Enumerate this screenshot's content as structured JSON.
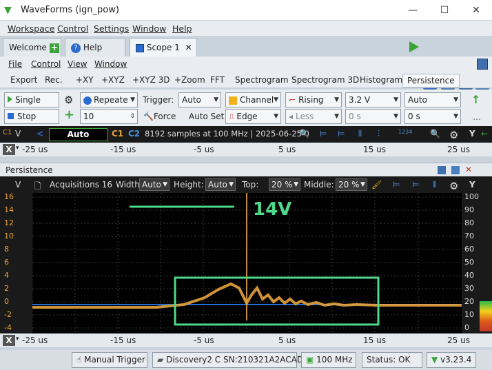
{
  "window": {
    "title": "WaveForms (ign_pow)"
  },
  "menu": [
    "Workspace",
    "Control",
    "Settings",
    "Window",
    "Help"
  ],
  "tabs": [
    {
      "label": "Welcome"
    },
    {
      "label": "Help"
    },
    {
      "label": "Scope 1"
    }
  ],
  "scope_menu": [
    "File",
    "Control",
    "View",
    "Window"
  ],
  "toolbar": [
    "Export",
    "Rec.",
    "+XY",
    "+XYZ",
    "+XYZ 3D",
    "+Zoom",
    "FFT",
    "Spectrogram",
    "Spectrogram 3D",
    "Histogram",
    "Persistence"
  ],
  "controls": {
    "single": "Single",
    "stop": "Stop",
    "repeat": "Repeate",
    "count": "10",
    "trigger_label": "Trigger:",
    "trigger_mode": "Auto",
    "force": "Force",
    "auto_set": "Auto Set",
    "source": "Channel",
    "type": "Edge",
    "condition": "Rising",
    "filter": "Less",
    "level": "3.2 V",
    "holdoff": "0 s",
    "auto2": "Auto",
    "pos": "0 s"
  },
  "scopebar": {
    "v_label": "V",
    "auto": "Auto",
    "c1": "C1",
    "c2": "C2",
    "info": "8192 samples at 100 MHz  | 2025-06-25 0",
    "y": "Y"
  },
  "xaxis": {
    "x": "X",
    "ticks": [
      "-25 us",
      "-15 us",
      "-5 us",
      "5 us",
      "15 us",
      "25 us"
    ]
  },
  "panel": {
    "title": "Persistence",
    "v_label": "V",
    "acq": "Acquisitions 16",
    "width_label": "Width:",
    "width": "Auto",
    "height_label": "Height:",
    "height": "Auto",
    "top_label": "Top:",
    "top": "20 %",
    "middle_label": "Middle:",
    "middle": "20 %",
    "y": "Y"
  },
  "y_left": [
    "16",
    "14",
    "12",
    "10",
    "8",
    "6",
    "4",
    "2",
    "0",
    "-2",
    "-4"
  ],
  "y_right": [
    "100",
    "90",
    "80",
    "70",
    "60",
    "50",
    "40",
    "30",
    "20",
    "10",
    "0"
  ],
  "annotation": "14V",
  "status": {
    "manual": "Manual Trigger",
    "device": "Discovery2 C SN:210321A2ACAD",
    "rate": "100 MHz",
    "status": "Status: OK",
    "version": "v3.23.4"
  },
  "colors": {
    "accent": "#3aa43a",
    "ch1": "#e6a23c",
    "ch2": "#1e6fd9",
    "annot": "#4ed88a"
  }
}
